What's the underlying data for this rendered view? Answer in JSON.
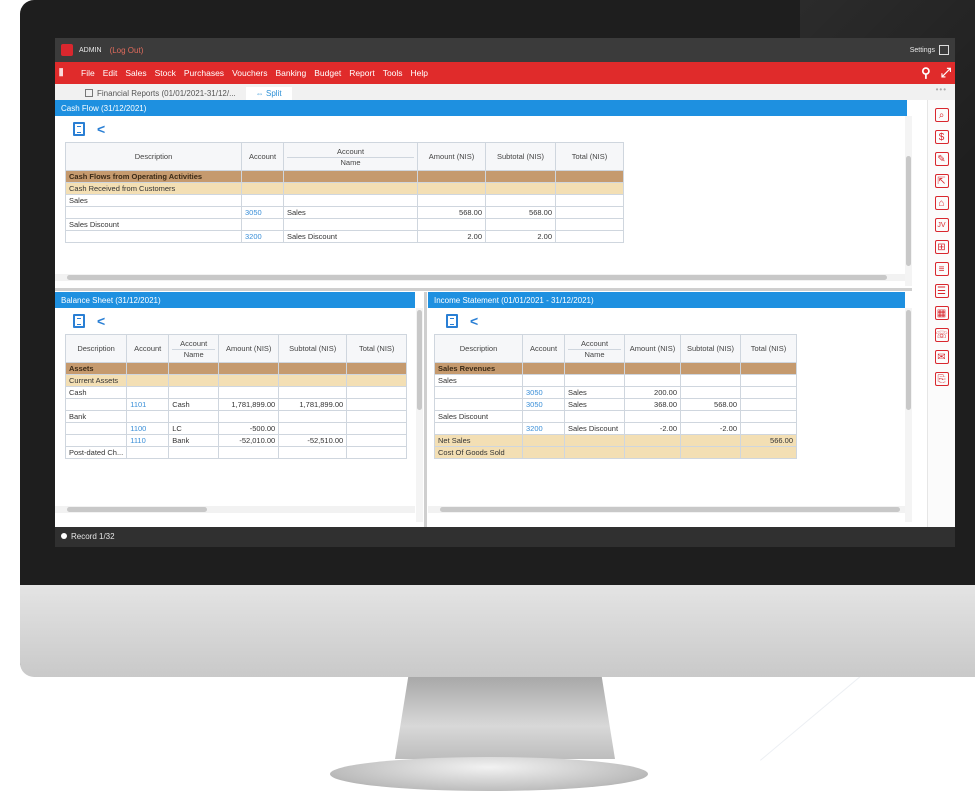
{
  "topbar": {
    "user": "ADMIN",
    "logout": "(Log Out)",
    "settings": "Settings"
  },
  "menu": [
    "File",
    "Edit",
    "Sales",
    "Stock",
    "Purchases",
    "Vouchers",
    "Banking",
    "Budget",
    "Report",
    "Tools",
    "Help"
  ],
  "tabs": {
    "report": "Financial Reports (01/01/2021-31/12/...",
    "split": "Split"
  },
  "columns": {
    "description": "Description",
    "account": "Account",
    "account_name_1": "Account",
    "account_name_2": "Name",
    "amount": "Amount (NIS)",
    "subtotal": "Subtotal (NIS)",
    "total": "Total (NIS)"
  },
  "cash_flow": {
    "title": "Cash Flow (31/12/2021)",
    "rows": [
      {
        "type": "sec",
        "desc": "Cash Flows from Operating Activities",
        "acct": "",
        "name": "",
        "amount": "",
        "subtotal": "",
        "total": ""
      },
      {
        "type": "sub",
        "desc": "Cash Received from Customers",
        "acct": "",
        "name": "",
        "amount": "",
        "subtotal": "",
        "total": ""
      },
      {
        "type": "",
        "desc": "Sales",
        "acct": "",
        "name": "",
        "amount": "",
        "subtotal": "",
        "total": ""
      },
      {
        "type": "",
        "desc": "",
        "acct": "3050",
        "name": "Sales",
        "amount": "568.00",
        "subtotal": "568.00",
        "total": ""
      },
      {
        "type": "",
        "desc": "Sales Discount",
        "acct": "",
        "name": "",
        "amount": "",
        "subtotal": "",
        "total": ""
      },
      {
        "type": "",
        "desc": "",
        "acct": "3200",
        "name": "Sales Discount",
        "amount": "2.00",
        "subtotal": "2.00",
        "total": ""
      }
    ]
  },
  "balance_sheet": {
    "title": "Balance Sheet (31/12/2021)",
    "rows": [
      {
        "type": "sec",
        "desc": "Assets",
        "acct": "",
        "name": "",
        "amount": "",
        "subtotal": "",
        "total": ""
      },
      {
        "type": "sub",
        "desc": "Current Assets",
        "acct": "",
        "name": "",
        "amount": "",
        "subtotal": "",
        "total": ""
      },
      {
        "type": "",
        "desc": "Cash",
        "acct": "",
        "name": "",
        "amount": "",
        "subtotal": "",
        "total": ""
      },
      {
        "type": "",
        "desc": "",
        "acct": "1101",
        "name": "Cash",
        "amount": "1,781,899.00",
        "subtotal": "1,781,899.00",
        "total": ""
      },
      {
        "type": "",
        "desc": "Bank",
        "acct": "",
        "name": "",
        "amount": "",
        "subtotal": "",
        "total": ""
      },
      {
        "type": "",
        "desc": "",
        "acct": "1100",
        "name": "LC",
        "amount": "-500.00",
        "subtotal": "",
        "total": ""
      },
      {
        "type": "",
        "desc": "",
        "acct": "1110",
        "name": "Bank",
        "amount": "-52,010.00",
        "subtotal": "-52,510.00",
        "total": ""
      },
      {
        "type": "",
        "desc": "Post-dated Ch...",
        "acct": "",
        "name": "",
        "amount": "",
        "subtotal": "",
        "total": ""
      }
    ]
  },
  "income_statement": {
    "title": "Income Statement (01/01/2021 - 31/12/2021)",
    "rows": [
      {
        "type": "sec",
        "desc": "Sales Revenues",
        "acct": "",
        "name": "",
        "amount": "",
        "subtotal": "",
        "total": ""
      },
      {
        "type": "",
        "desc": "Sales",
        "acct": "",
        "name": "",
        "amount": "",
        "subtotal": "",
        "total": ""
      },
      {
        "type": "",
        "desc": "",
        "acct": "3050",
        "name": "Sales",
        "amount": "200.00",
        "subtotal": "",
        "total": ""
      },
      {
        "type": "",
        "desc": "",
        "acct": "3050",
        "name": "Sales",
        "amount": "368.00",
        "subtotal": "568.00",
        "total": ""
      },
      {
        "type": "",
        "desc": "Sales Discount",
        "acct": "",
        "name": "",
        "amount": "",
        "subtotal": "",
        "total": ""
      },
      {
        "type": "",
        "desc": "",
        "acct": "3200",
        "name": "Sales Discount",
        "amount": "-2.00",
        "subtotal": "-2.00",
        "total": ""
      },
      {
        "type": "sub",
        "desc": "Net Sales",
        "acct": "",
        "name": "",
        "amount": "",
        "subtotal": "",
        "total": "566.00"
      },
      {
        "type": "sub",
        "desc": "Cost Of Goods Sold",
        "acct": "",
        "name": "",
        "amount": "",
        "subtotal": "",
        "total": ""
      }
    ]
  },
  "status": {
    "record": "Record 1/32"
  },
  "sidebar_icons": [
    "report-search-icon",
    "coins-icon",
    "invoice-edit-icon",
    "export-icon",
    "bank-icon",
    "journal-voucher-icon",
    "cash-register-icon",
    "receipt-icon",
    "ledger-icon",
    "calendar-icon",
    "contacts-icon",
    "cheque-icon",
    "statement-icon"
  ]
}
